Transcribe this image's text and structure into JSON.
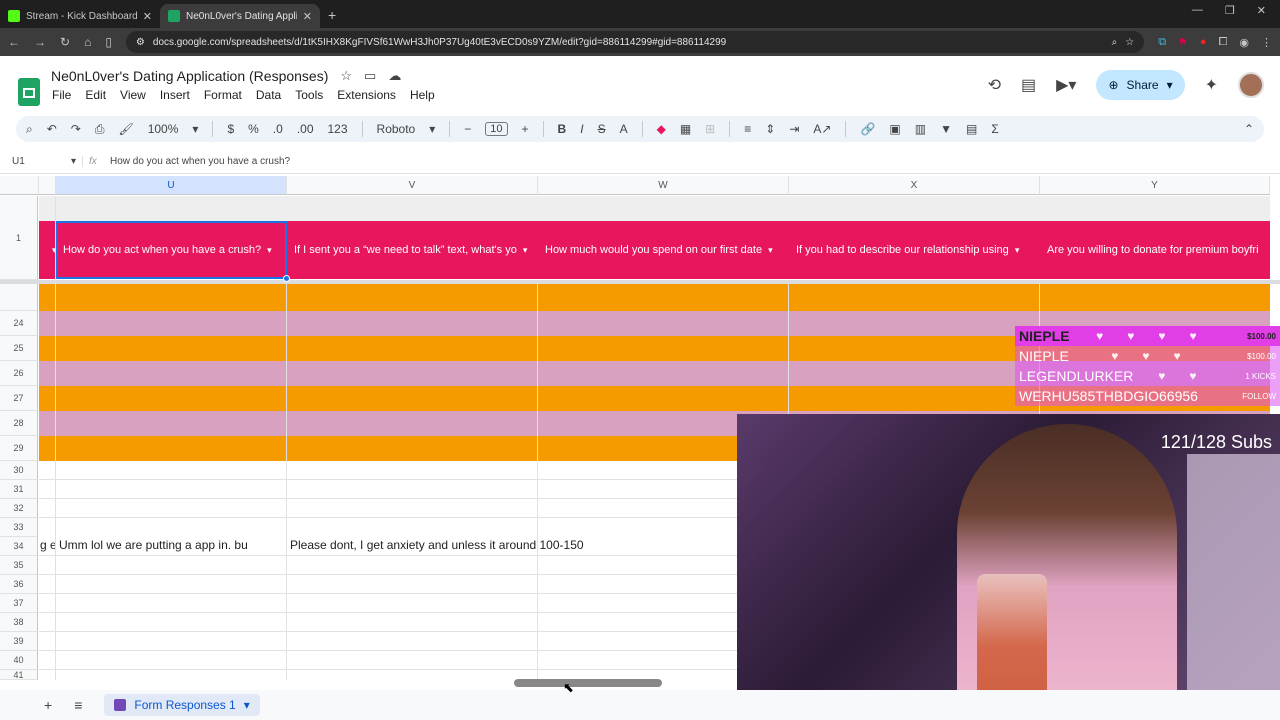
{
  "browser": {
    "tabs": [
      {
        "title": "Stream - Kick Dashboard",
        "favicon_color": "#53fc18"
      },
      {
        "title": "Ne0nL0ver's Dating Applicatio",
        "favicon_color": "#1ea362"
      }
    ],
    "new_tab_label": "+",
    "url": "docs.google.com/spreadsheets/d/1tK5IHX8KgFIVSf61WwH3Jh0P37Ug40tE3vECD0s9YZM/edit?gid=886114299#gid=886114299"
  },
  "sheets": {
    "doc_title": "Ne0nL0ver's Dating Application (Responses)",
    "menu": [
      "File",
      "Edit",
      "View",
      "Insert",
      "Format",
      "Data",
      "Tools",
      "Extensions",
      "Help"
    ],
    "share_label": "Share",
    "toolbar": {
      "zoom": "100%",
      "currency": "$",
      "percent": "%",
      "dec_down": ".0",
      "dec_up": ".00",
      "number_format": "123",
      "font": "Roboto",
      "font_size": "10"
    },
    "name_box": "U1",
    "formula": "How do you act when you have a crush?",
    "columns": [
      "U",
      "V",
      "W",
      "X",
      "Y"
    ],
    "header_row_number": "1",
    "headers": [
      "How do you act when you have a crush?",
      "If I sent you a “we need to talk” text, what's yo",
      "How much would you spend on our first date",
      "If you had to describe our relationship using",
      "Are you willing to donate for premium boyfri"
    ],
    "rows": [
      "24",
      "25",
      "26",
      "27",
      "28",
      "29",
      "30",
      "31",
      "32",
      "33",
      "34",
      "35",
      "36",
      "37",
      "38",
      "39",
      "40",
      "41"
    ],
    "row34_text": {
      "t_col": "g e",
      "u_col": "Umm lol we are putting a app in. bu",
      "v_col": "Please dont, I get anxiety and unless it around 100-150"
    },
    "sheet_tab": "Form Responses 1",
    "colors": {
      "header_bg": "#e8175d",
      "orange_band": "#f59b00",
      "pink_band": "#d9a1c0"
    }
  },
  "stream_overlay": {
    "alerts": [
      {
        "name": "NIEPLE",
        "amount": "$100.00"
      },
      {
        "name": "NIEPLE",
        "amount": "$100.00"
      },
      {
        "name": "LEGENDLURKER",
        "amount": "1 KICKS"
      },
      {
        "name": "WERHU585THBDGIO66956",
        "amount": "FOLLOW"
      }
    ],
    "subs": "121/128 Subs"
  }
}
